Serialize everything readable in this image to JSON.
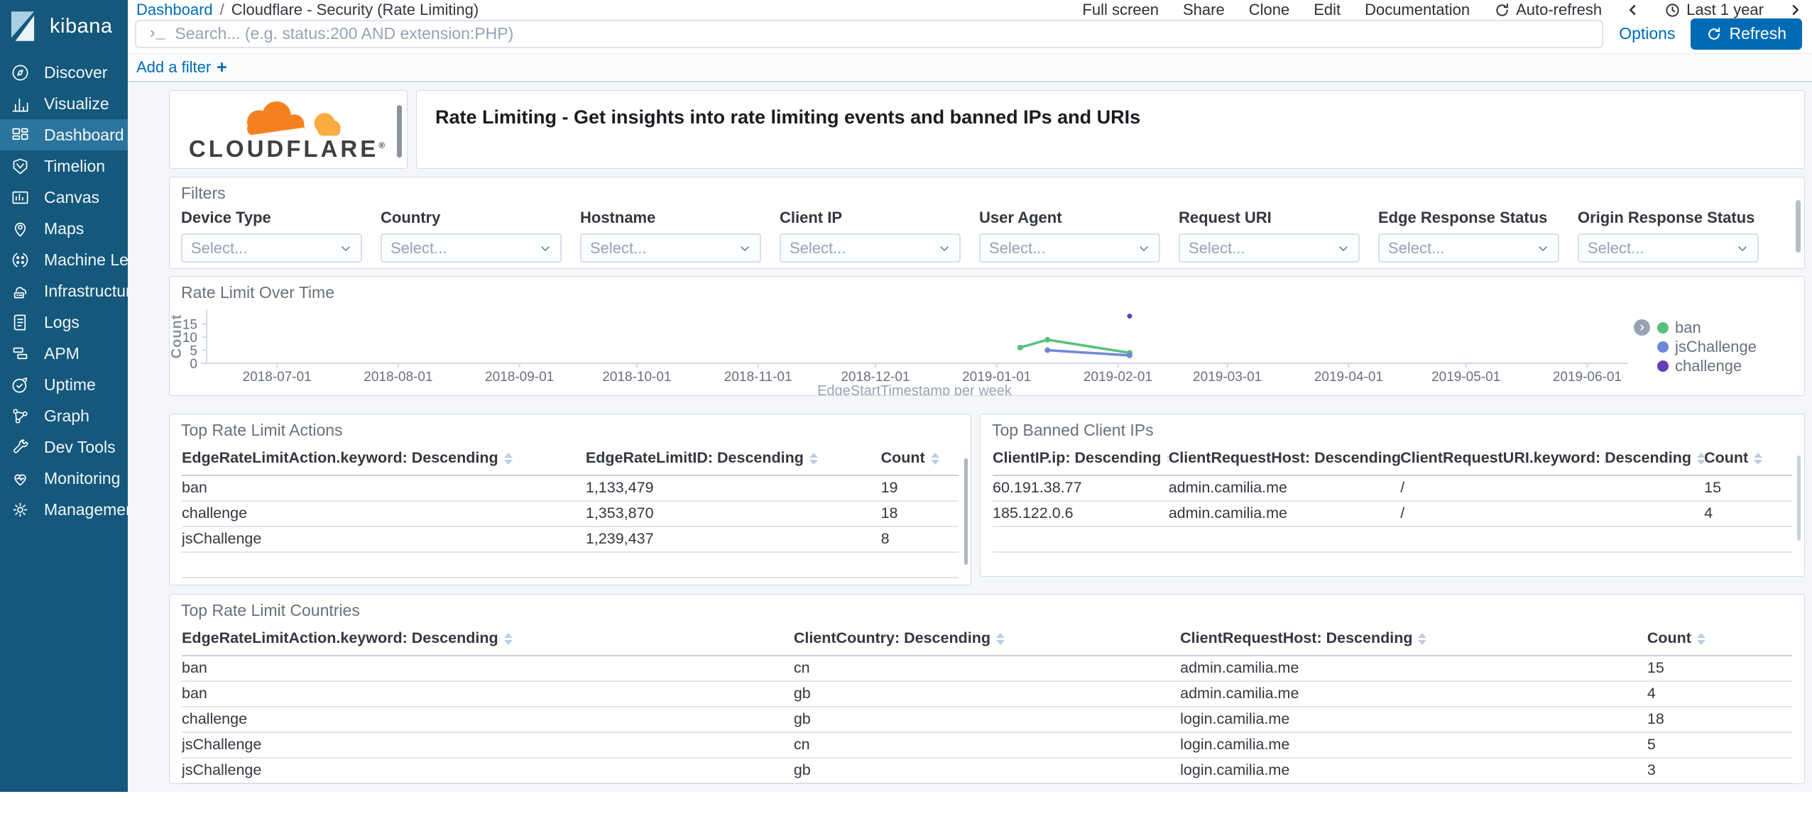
{
  "app": {
    "name": "kibana"
  },
  "colors": {
    "primary": "#006bb4",
    "sidebar": "#14587c",
    "sidebar_active": "#2b749c",
    "cloudflare_orange": "#f48120",
    "cloudflare_light_orange": "#faad3f",
    "series_green": "#57c17b",
    "series_blue": "#6f87d8",
    "series_purple": "#663db8"
  },
  "sidebar": {
    "items": [
      {
        "label": "Discover",
        "icon": "compass-icon",
        "active": false
      },
      {
        "label": "Visualize",
        "icon": "bar-chart-icon",
        "active": false
      },
      {
        "label": "Dashboard",
        "icon": "dashboard-icon",
        "active": true
      },
      {
        "label": "Timelion",
        "icon": "timelion-icon",
        "active": false
      },
      {
        "label": "Canvas",
        "icon": "canvas-icon",
        "active": false
      },
      {
        "label": "Maps",
        "icon": "map-pin-icon",
        "active": false
      },
      {
        "label": "Machine Le...",
        "icon": "machine-learning-icon",
        "active": false
      },
      {
        "label": "Infrastructure",
        "icon": "infrastructure-icon",
        "active": false
      },
      {
        "label": "Logs",
        "icon": "logs-icon",
        "active": false
      },
      {
        "label": "APM",
        "icon": "apm-icon",
        "active": false
      },
      {
        "label": "Uptime",
        "icon": "uptime-icon",
        "active": false
      },
      {
        "label": "Graph",
        "icon": "graph-icon",
        "active": false
      },
      {
        "label": "Dev Tools",
        "icon": "wrench-icon",
        "active": false
      },
      {
        "label": "Monitoring",
        "icon": "heartbeat-icon",
        "active": false
      },
      {
        "label": "Management",
        "icon": "gear-icon",
        "active": false
      }
    ]
  },
  "topnav": {
    "breadcrumb": {
      "root": "Dashboard",
      "separator": "/",
      "current": "Cloudflare - Security (Rate Limiting)"
    },
    "actions": [
      "Full screen",
      "Share",
      "Clone",
      "Edit",
      "Documentation"
    ],
    "auto_refresh_label": "Auto-refresh",
    "time_label": "Last 1 year"
  },
  "search": {
    "prompt": "›_",
    "placeholder": "Search... (e.g. status:200 AND extension:PHP)",
    "options_label": "Options",
    "refresh_label": "Refresh"
  },
  "filter_bar": {
    "add_label": "Add a filter",
    "plus": "+"
  },
  "panels": {
    "branding": {
      "logo_text": "CLOUDFLARE",
      "registered_mark": "®"
    },
    "header": {
      "text": "Rate Limiting - Get insights into rate limiting events and banned IPs and URIs"
    },
    "filters": {
      "title": "Filters",
      "placeholder": "Select...",
      "fields": [
        "Device Type",
        "Country",
        "Hostname",
        "Client IP",
        "User Agent",
        "Request URI",
        "Edge Response Status",
        "Origin Response Status"
      ]
    },
    "tables": {
      "actions": {
        "title": "Top Rate Limit Actions",
        "columns": [
          "EdgeRateLimitAction.keyword: Descending",
          "EdgeRateLimitID: Descending",
          "Count"
        ],
        "rows": [
          [
            "ban",
            "1,133,479",
            "19"
          ],
          [
            "challenge",
            "1,353,870",
            "18"
          ],
          [
            "jsChallenge",
            "1,239,437",
            "8"
          ]
        ],
        "empty_rows": 2
      },
      "banned": {
        "title": "Top Banned Client IPs",
        "columns": [
          "ClientIP.ip: Descending",
          "ClientRequestHost: Descending",
          "ClientRequestURI.keyword: Descending",
          "Count"
        ],
        "rows": [
          [
            "60.191.38.77",
            "admin.camilia.me",
            "/",
            "15"
          ],
          [
            "185.122.0.6",
            "admin.camilia.me",
            "/",
            "4"
          ]
        ],
        "empty_rows": 2
      },
      "countries": {
        "title": "Top Rate Limit Countries",
        "columns": [
          "EdgeRateLimitAction.keyword: Descending",
          "ClientCountry: Descending",
          "ClientRequestHost: Descending",
          "Count"
        ],
        "rows": [
          [
            "ban",
            "cn",
            "admin.camilia.me",
            "15"
          ],
          [
            "ban",
            "gb",
            "admin.camilia.me",
            "4"
          ],
          [
            "challenge",
            "gb",
            "login.camilia.me",
            "18"
          ],
          [
            "jsChallenge",
            "cn",
            "login.camilia.me",
            "5"
          ],
          [
            "jsChallenge",
            "gb",
            "login.camilia.me",
            "3"
          ]
        ],
        "empty_rows": 0
      }
    }
  },
  "chart_data": {
    "type": "line",
    "title": "Rate Limit Over Time",
    "xlabel": "EdgeStartTimestamp per week",
    "ylabel": "Count",
    "x_range": [
      "2018-06-13",
      "2019-06-10"
    ],
    "x_ticks": [
      "2018-07-01",
      "2018-08-01",
      "2018-09-01",
      "2018-10-01",
      "2018-11-01",
      "2018-12-01",
      "2019-01-01",
      "2019-02-01",
      "2019-03-01",
      "2019-04-01",
      "2019-05-01",
      "2019-06-01"
    ],
    "ylim": [
      0,
      19.5
    ],
    "y_ticks": [
      0,
      5,
      10,
      15
    ],
    "grid": false,
    "legend_position": "right",
    "series": [
      {
        "name": "ban",
        "color": "#57c17b",
        "points": [
          [
            "2019-01-07",
            6
          ],
          [
            "2019-01-14",
            9
          ],
          [
            "2019-02-04",
            4
          ]
        ]
      },
      {
        "name": "jsChallenge",
        "color": "#6f87d8",
        "points": [
          [
            "2019-01-14",
            5
          ],
          [
            "2019-02-04",
            3
          ]
        ]
      },
      {
        "name": "challenge",
        "color": "#663db8",
        "points": [
          [
            "2019-02-04",
            18
          ]
        ]
      }
    ]
  }
}
